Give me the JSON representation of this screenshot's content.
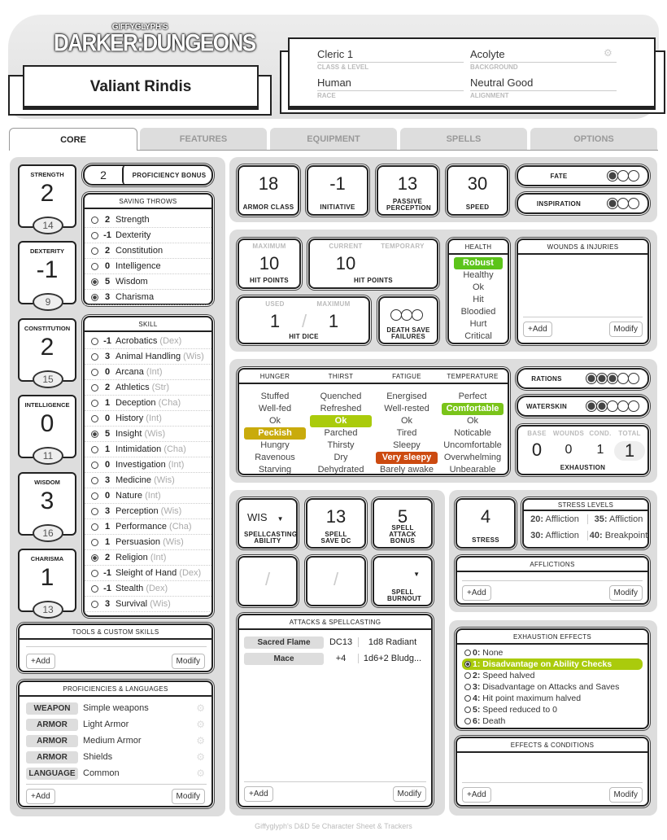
{
  "header": {
    "logo_top": "GIFFYGLYPH'S",
    "logo_main": "DARKER:DUNGEONS",
    "character_name": "Valiant Rindis",
    "class_level": "Cleric 1",
    "class_level_label": "CLASS & LEVEL",
    "background": "Acolyte",
    "background_label": "BACKGROUND",
    "race": "Human",
    "race_label": "RACE",
    "alignment": "Neutral Good",
    "alignment_label": "ALIGNMENT"
  },
  "tabs": [
    "CORE",
    "FEATURES",
    "EQUIPMENT",
    "SPELLS",
    "OPTIONS"
  ],
  "abilities": [
    {
      "name": "STRENGTH",
      "mod": "2",
      "score": "14"
    },
    {
      "name": "DEXTERITY",
      "mod": "-1",
      "score": "9"
    },
    {
      "name": "CONSTITUTION",
      "mod": "2",
      "score": "15"
    },
    {
      "name": "INTELLIGENCE",
      "mod": "0",
      "score": "11"
    },
    {
      "name": "WISDOM",
      "mod": "3",
      "score": "16"
    },
    {
      "name": "CHARISMA",
      "mod": "1",
      "score": "13"
    }
  ],
  "proficiency": {
    "value": "2",
    "label": "PROFICIENCY BONUS"
  },
  "saving_throws": {
    "title": "SAVING THROWS",
    "items": [
      {
        "mod": "2",
        "name": "Strength",
        "prof": false
      },
      {
        "mod": "-1",
        "name": "Dexterity",
        "prof": false
      },
      {
        "mod": "2",
        "name": "Constitution",
        "prof": false
      },
      {
        "mod": "0",
        "name": "Intelligence",
        "prof": false
      },
      {
        "mod": "5",
        "name": "Wisdom",
        "prof": true
      },
      {
        "mod": "3",
        "name": "Charisma",
        "prof": true
      }
    ]
  },
  "skills": {
    "title": "SKILL",
    "items": [
      {
        "mod": "-1",
        "name": "Acrobatics",
        "attr": "(Dex)",
        "prof": false
      },
      {
        "mod": "3",
        "name": "Animal Handling",
        "attr": "(Wis)",
        "prof": false
      },
      {
        "mod": "0",
        "name": "Arcana",
        "attr": "(Int)",
        "prof": false
      },
      {
        "mod": "2",
        "name": "Athletics",
        "attr": "(Str)",
        "prof": false
      },
      {
        "mod": "1",
        "name": "Deception",
        "attr": "(Cha)",
        "prof": false
      },
      {
        "mod": "0",
        "name": "History",
        "attr": "(Int)",
        "prof": false
      },
      {
        "mod": "5",
        "name": "Insight",
        "attr": "(Wis)",
        "prof": true
      },
      {
        "mod": "1",
        "name": "Intimidation",
        "attr": "(Cha)",
        "prof": false
      },
      {
        "mod": "0",
        "name": "Investigation",
        "attr": "(Int)",
        "prof": false
      },
      {
        "mod": "3",
        "name": "Medicine",
        "attr": "(Wis)",
        "prof": false
      },
      {
        "mod": "0",
        "name": "Nature",
        "attr": "(Int)",
        "prof": false
      },
      {
        "mod": "3",
        "name": "Perception",
        "attr": "(Wis)",
        "prof": false
      },
      {
        "mod": "1",
        "name": "Performance",
        "attr": "(Cha)",
        "prof": false
      },
      {
        "mod": "1",
        "name": "Persuasion",
        "attr": "(Wis)",
        "prof": false
      },
      {
        "mod": "2",
        "name": "Religion",
        "attr": "(Int)",
        "prof": true
      },
      {
        "mod": "-1",
        "name": "Sleight of Hand",
        "attr": "(Dex)",
        "prof": false
      },
      {
        "mod": "-1",
        "name": "Stealth",
        "attr": "(Dex)",
        "prof": false
      },
      {
        "mod": "3",
        "name": "Survival",
        "attr": "(Wis)",
        "prof": false
      }
    ]
  },
  "tools": {
    "title": "TOOLS & CUSTOM SKILLS",
    "add": "+Add",
    "modify": "Modify"
  },
  "proficiencies": {
    "title": "PROFICIENCIES & LANGUAGES",
    "add": "+Add",
    "modify": "Modify",
    "items": [
      {
        "type": "WEAPON",
        "name": "Simple weapons"
      },
      {
        "type": "ARMOR",
        "name": "Light Armor"
      },
      {
        "type": "ARMOR",
        "name": "Medium Armor"
      },
      {
        "type": "ARMOR",
        "name": "Shields"
      },
      {
        "type": "LANGUAGE",
        "name": "Common"
      }
    ]
  },
  "combat": {
    "ac": "18",
    "ac_label": "ARMOR CLASS",
    "initiative": "-1",
    "initiative_label": "INITIATIVE",
    "passive": "13",
    "passive_label": "PASSIVE PERCEPTION",
    "speed": "30",
    "speed_label": "SPEED"
  },
  "fate": {
    "label": "FATE",
    "filled": 1,
    "total": 3
  },
  "inspiration": {
    "label": "INSPIRATION",
    "filled": 1,
    "total": 3
  },
  "hp": {
    "max_label": "MAXIMUM",
    "max": "10",
    "hp_label": "HIT POINTS",
    "current_label": "CURRENT",
    "temp_label": "TEMPORARY",
    "current": "10",
    "temp": ""
  },
  "hit_dice": {
    "used_label": "USED",
    "max_label": "MAXIMUM",
    "used": "1",
    "max": "1",
    "label": "HIT DICE",
    "sep": "/"
  },
  "death_saves": {
    "label": "DEATH SAVE FAILURES",
    "filled": 0,
    "total": 3
  },
  "health": {
    "title": "HEALTH",
    "states": [
      "Robust",
      "Healthy",
      "Ok",
      "Hit",
      "Bloodied",
      "Hurt",
      "Critical"
    ],
    "active": 0,
    "color": "#5cc41a"
  },
  "wounds": {
    "title": "WOUNDS & INJURIES",
    "add": "+Add",
    "modify": "Modify"
  },
  "survival": {
    "columns": [
      {
        "title": "HUNGER",
        "states": [
          "Stuffed",
          "Well-fed",
          "Ok",
          "Peckish",
          "Hungry",
          "Ravenous",
          "Starving"
        ],
        "active": 3,
        "color": "#c9ab0c"
      },
      {
        "title": "THIRST",
        "states": [
          "Quenched",
          "Refreshed",
          "Ok",
          "Parched",
          "Thirsty",
          "Dry",
          "Dehydrated"
        ],
        "active": 2,
        "color": "#aacb0c"
      },
      {
        "title": "FATIGUE",
        "states": [
          "Energised",
          "Well-rested",
          "Ok",
          "Tired",
          "Sleepy",
          "Very sleepy",
          "Barely awake"
        ],
        "active": 5,
        "color": "#cc4a10"
      },
      {
        "title": "TEMPERATURE",
        "states": [
          "Perfect",
          "Comfortable",
          "Ok",
          "Noticable",
          "Uncomfortable",
          "Overwhelming",
          "Unbearable"
        ],
        "active": 1,
        "color": "#7ac41a"
      }
    ]
  },
  "rations": {
    "label": "RATIONS",
    "filled": 3,
    "total": 5
  },
  "waterskin": {
    "label": "WATERSKIN",
    "filled": 2,
    "total": 5
  },
  "exhaustion": {
    "base_label": "BASE",
    "wounds_label": "WOUNDS",
    "cond_label": "COND.",
    "total_label": "TOTAL",
    "base": "0",
    "wounds": "0",
    "cond": "1",
    "total": "1",
    "label": "EXHAUSTION"
  },
  "spellcasting": {
    "ability": "WIS",
    "ability_label": "SPELLCASTING ABILITY",
    "save_dc": "13",
    "save_dc_label": "SPELL SAVE DC",
    "attack": "5",
    "attack_label": "SPELL ATTACK BONUS",
    "slot_sep": "/",
    "burnout_label": "SPELL BURNOUT"
  },
  "attacks": {
    "title": "ATTACKS & SPELLCASTING",
    "add": "+Add",
    "modify": "Modify",
    "items": [
      {
        "name": "Sacred Flame",
        "bonus": "DC13",
        "damage": "1d8 Radiant"
      },
      {
        "name": "Mace",
        "bonus": "+4",
        "damage": "1d6+2 Bludg..."
      }
    ]
  },
  "stress": {
    "value": "4",
    "label": "STRESS",
    "levels_title": "STRESS LEVELS",
    "levels": [
      {
        "n": "20:",
        "t": "Affliction"
      },
      {
        "n": "35:",
        "t": "Affliction"
      },
      {
        "n": "30:",
        "t": "Affliction"
      },
      {
        "n": "40:",
        "t": "Breakpoint"
      }
    ]
  },
  "afflictions": {
    "title": "AFFLICTIONS",
    "add": "+Add",
    "modify": "Modify"
  },
  "exhaustion_effects": {
    "title": "EXHAUSTION EFFECTS",
    "active": 1,
    "color": "#aacb0c",
    "items": [
      {
        "n": "0:",
        "t": "None"
      },
      {
        "n": "1:",
        "t": "Disadvantage on Ability Checks"
      },
      {
        "n": "2:",
        "t": "Speed halved"
      },
      {
        "n": "3:",
        "t": "Disadvantage on Attacks and Saves"
      },
      {
        "n": "4:",
        "t": "Hit point maximum halved"
      },
      {
        "n": "5:",
        "t": "Speed reduced to 0"
      },
      {
        "n": "6:",
        "t": "Death"
      }
    ]
  },
  "effects": {
    "title": "EFFECTS & CONDITIONS",
    "add": "+Add",
    "modify": "Modify"
  },
  "footer": "Giffyglyph's D&D 5e Character Sheet & Trackers"
}
